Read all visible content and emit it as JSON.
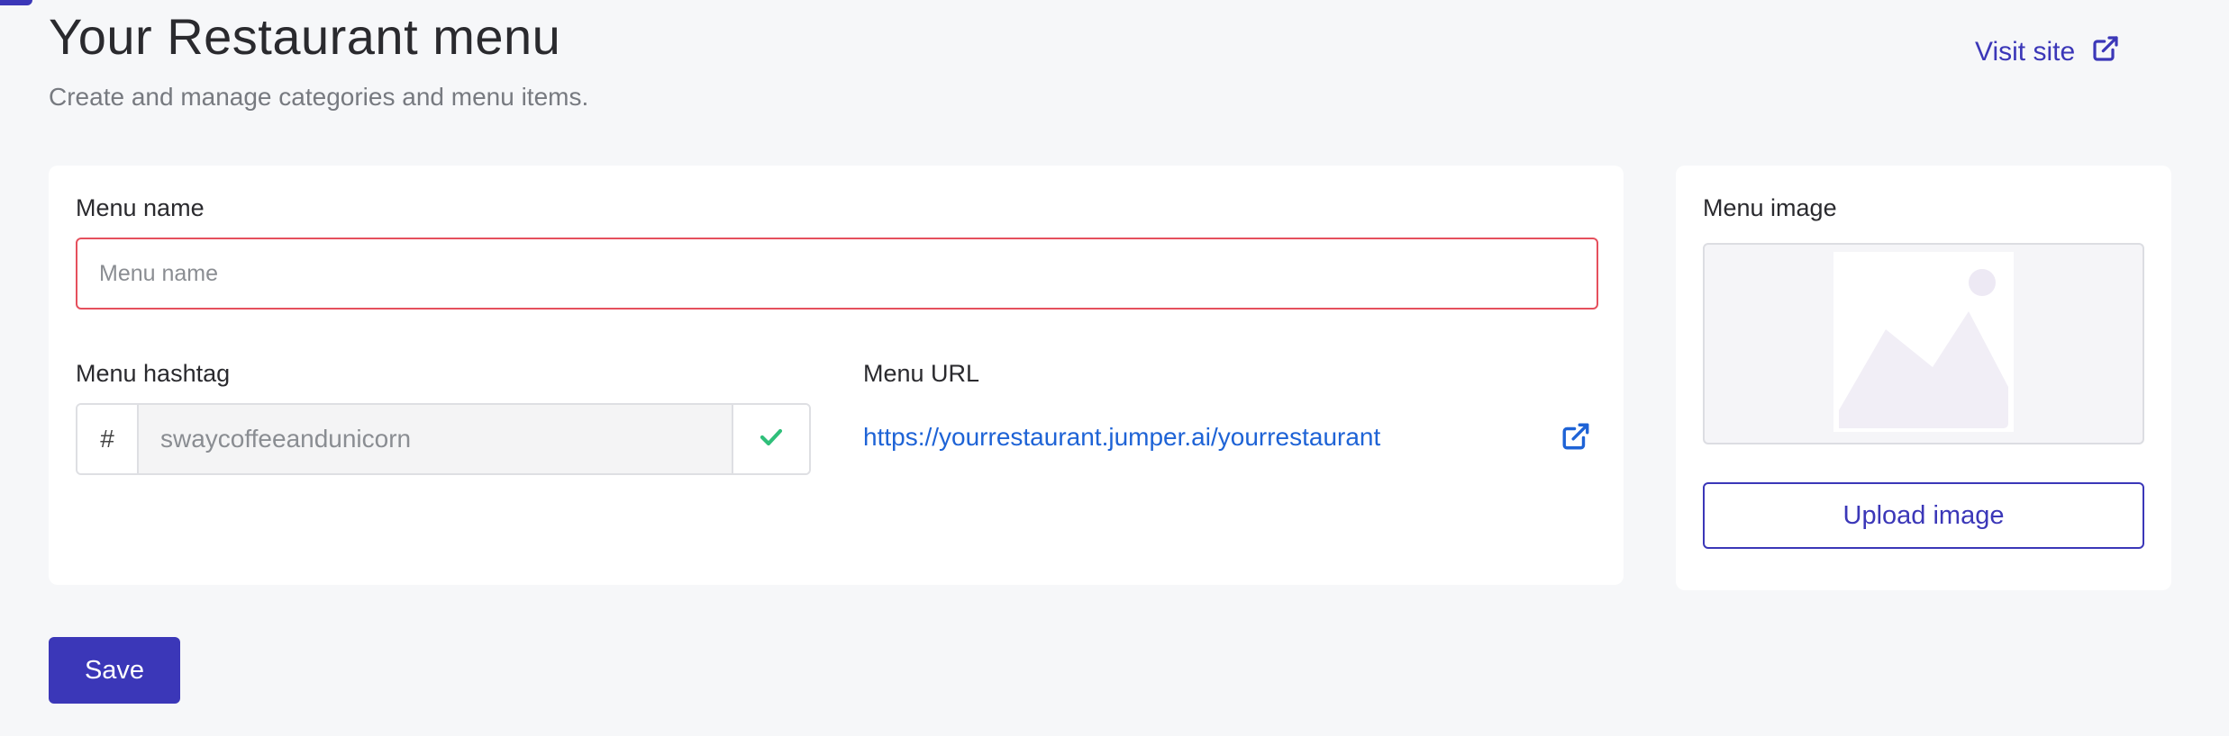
{
  "header": {
    "title": "Your Restaurant menu",
    "subtitle": "Create and manage categories and menu items.",
    "visit_site_label": "Visit site"
  },
  "form": {
    "menu_name": {
      "label": "Menu name",
      "value": "",
      "placeholder": "Menu name"
    },
    "menu_hashtag": {
      "label": "Menu hashtag",
      "prefix": "#",
      "value": "swaycoffeeandunicorn"
    },
    "menu_url": {
      "label": "Menu URL",
      "value": "https://yourrestaurant.jumper.ai/yourrestaurant"
    }
  },
  "image_panel": {
    "label": "Menu image",
    "upload_label": "Upload image"
  },
  "actions": {
    "save_label": "Save"
  },
  "icons": {
    "visit_site": "external-link-icon",
    "hashtag_status": "check-icon",
    "url_open": "external-link-icon",
    "image_placeholder": "image-placeholder-icon"
  },
  "colors": {
    "accent": "#3b37b8",
    "link": "#1e63d6",
    "error_border": "#e5505d",
    "success": "#2fbf7a",
    "background": "#f6f7f9"
  }
}
